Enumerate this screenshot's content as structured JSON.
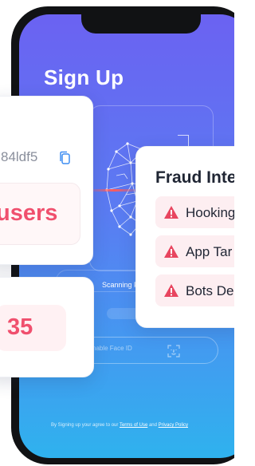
{
  "phone": {
    "title": "Sign Up",
    "scan_status": "Scanning Fa",
    "faceid_label": "nable Face ID",
    "terms": {
      "prefix": "By Signing up your agree to our ",
      "terms_link": "Terms of Use",
      "mid": " and ",
      "privacy_link": "Privacy Policy"
    }
  },
  "card_id": {
    "device_id": "84ldf5",
    "users_label": "users"
  },
  "card_count": {
    "value": "35"
  },
  "card_fraud": {
    "title": "Fraud Inte",
    "items": [
      {
        "label": "Hooking"
      },
      {
        "label": "App Tar"
      },
      {
        "label": "Bots De"
      }
    ]
  },
  "colors": {
    "accent_red": "#f0506e",
    "warning_red": "#e8455f",
    "gradient_top": "#6b62f2",
    "gradient_bottom": "#2fb2ee"
  },
  "icons": [
    "copy-icon",
    "warning-icon",
    "face-scan-icon",
    "face-mesh-illustration"
  ]
}
